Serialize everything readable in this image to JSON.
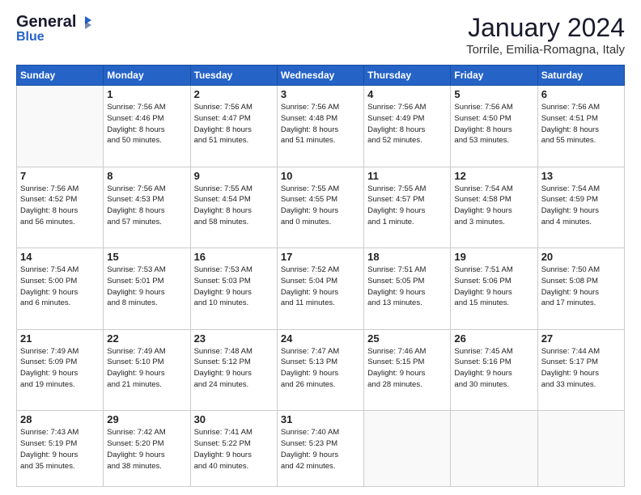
{
  "header": {
    "logo_general": "General",
    "logo_blue": "Blue",
    "month_title": "January 2024",
    "location": "Torrile, Emilia-Romagna, Italy"
  },
  "days_of_week": [
    "Sunday",
    "Monday",
    "Tuesday",
    "Wednesday",
    "Thursday",
    "Friday",
    "Saturday"
  ],
  "weeks": [
    [
      {
        "day": "",
        "info": ""
      },
      {
        "day": "1",
        "info": "Sunrise: 7:56 AM\nSunset: 4:46 PM\nDaylight: 8 hours\nand 50 minutes."
      },
      {
        "day": "2",
        "info": "Sunrise: 7:56 AM\nSunset: 4:47 PM\nDaylight: 8 hours\nand 51 minutes."
      },
      {
        "day": "3",
        "info": "Sunrise: 7:56 AM\nSunset: 4:48 PM\nDaylight: 8 hours\nand 51 minutes."
      },
      {
        "day": "4",
        "info": "Sunrise: 7:56 AM\nSunset: 4:49 PM\nDaylight: 8 hours\nand 52 minutes."
      },
      {
        "day": "5",
        "info": "Sunrise: 7:56 AM\nSunset: 4:50 PM\nDaylight: 8 hours\nand 53 minutes."
      },
      {
        "day": "6",
        "info": "Sunrise: 7:56 AM\nSunset: 4:51 PM\nDaylight: 8 hours\nand 55 minutes."
      }
    ],
    [
      {
        "day": "7",
        "info": "Sunrise: 7:56 AM\nSunset: 4:52 PM\nDaylight: 8 hours\nand 56 minutes."
      },
      {
        "day": "8",
        "info": "Sunrise: 7:56 AM\nSunset: 4:53 PM\nDaylight: 8 hours\nand 57 minutes."
      },
      {
        "day": "9",
        "info": "Sunrise: 7:55 AM\nSunset: 4:54 PM\nDaylight: 8 hours\nand 58 minutes."
      },
      {
        "day": "10",
        "info": "Sunrise: 7:55 AM\nSunset: 4:55 PM\nDaylight: 9 hours\nand 0 minutes."
      },
      {
        "day": "11",
        "info": "Sunrise: 7:55 AM\nSunset: 4:57 PM\nDaylight: 9 hours\nand 1 minute."
      },
      {
        "day": "12",
        "info": "Sunrise: 7:54 AM\nSunset: 4:58 PM\nDaylight: 9 hours\nand 3 minutes."
      },
      {
        "day": "13",
        "info": "Sunrise: 7:54 AM\nSunset: 4:59 PM\nDaylight: 9 hours\nand 4 minutes."
      }
    ],
    [
      {
        "day": "14",
        "info": "Sunrise: 7:54 AM\nSunset: 5:00 PM\nDaylight: 9 hours\nand 6 minutes."
      },
      {
        "day": "15",
        "info": "Sunrise: 7:53 AM\nSunset: 5:01 PM\nDaylight: 9 hours\nand 8 minutes."
      },
      {
        "day": "16",
        "info": "Sunrise: 7:53 AM\nSunset: 5:03 PM\nDaylight: 9 hours\nand 10 minutes."
      },
      {
        "day": "17",
        "info": "Sunrise: 7:52 AM\nSunset: 5:04 PM\nDaylight: 9 hours\nand 11 minutes."
      },
      {
        "day": "18",
        "info": "Sunrise: 7:51 AM\nSunset: 5:05 PM\nDaylight: 9 hours\nand 13 minutes."
      },
      {
        "day": "19",
        "info": "Sunrise: 7:51 AM\nSunset: 5:06 PM\nDaylight: 9 hours\nand 15 minutes."
      },
      {
        "day": "20",
        "info": "Sunrise: 7:50 AM\nSunset: 5:08 PM\nDaylight: 9 hours\nand 17 minutes."
      }
    ],
    [
      {
        "day": "21",
        "info": "Sunrise: 7:49 AM\nSunset: 5:09 PM\nDaylight: 9 hours\nand 19 minutes."
      },
      {
        "day": "22",
        "info": "Sunrise: 7:49 AM\nSunset: 5:10 PM\nDaylight: 9 hours\nand 21 minutes."
      },
      {
        "day": "23",
        "info": "Sunrise: 7:48 AM\nSunset: 5:12 PM\nDaylight: 9 hours\nand 24 minutes."
      },
      {
        "day": "24",
        "info": "Sunrise: 7:47 AM\nSunset: 5:13 PM\nDaylight: 9 hours\nand 26 minutes."
      },
      {
        "day": "25",
        "info": "Sunrise: 7:46 AM\nSunset: 5:15 PM\nDaylight: 9 hours\nand 28 minutes."
      },
      {
        "day": "26",
        "info": "Sunrise: 7:45 AM\nSunset: 5:16 PM\nDaylight: 9 hours\nand 30 minutes."
      },
      {
        "day": "27",
        "info": "Sunrise: 7:44 AM\nSunset: 5:17 PM\nDaylight: 9 hours\nand 33 minutes."
      }
    ],
    [
      {
        "day": "28",
        "info": "Sunrise: 7:43 AM\nSunset: 5:19 PM\nDaylight: 9 hours\nand 35 minutes."
      },
      {
        "day": "29",
        "info": "Sunrise: 7:42 AM\nSunset: 5:20 PM\nDaylight: 9 hours\nand 38 minutes."
      },
      {
        "day": "30",
        "info": "Sunrise: 7:41 AM\nSunset: 5:22 PM\nDaylight: 9 hours\nand 40 minutes."
      },
      {
        "day": "31",
        "info": "Sunrise: 7:40 AM\nSunset: 5:23 PM\nDaylight: 9 hours\nand 42 minutes."
      },
      {
        "day": "",
        "info": ""
      },
      {
        "day": "",
        "info": ""
      },
      {
        "day": "",
        "info": ""
      }
    ]
  ]
}
